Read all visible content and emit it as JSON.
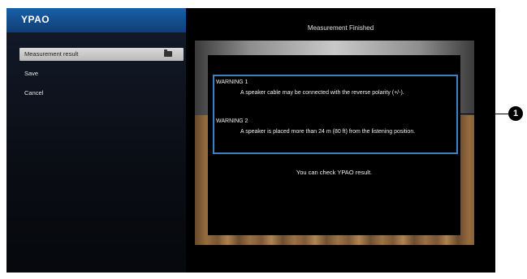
{
  "app": {
    "logo": "YPAO"
  },
  "sidebar": {
    "items": [
      {
        "label": "Measurement result"
      },
      {
        "label": "Save"
      },
      {
        "label": "Cancel"
      }
    ]
  },
  "main": {
    "title": "Measurement Finished",
    "warnings": [
      {
        "title": "WARNING 1",
        "text": "A speaker cable may be connected with the reverse polarity (+/-)."
      },
      {
        "title": "WARNING 2",
        "text": "A speaker is placed more than 24 m (80 ft) from the listening position."
      }
    ],
    "check_text": "You can check YPAO result."
  },
  "annotations": {
    "callout_1": "1"
  },
  "colors": {
    "highlight_box": "#3b83c4",
    "brand": "#1a5fa6"
  }
}
